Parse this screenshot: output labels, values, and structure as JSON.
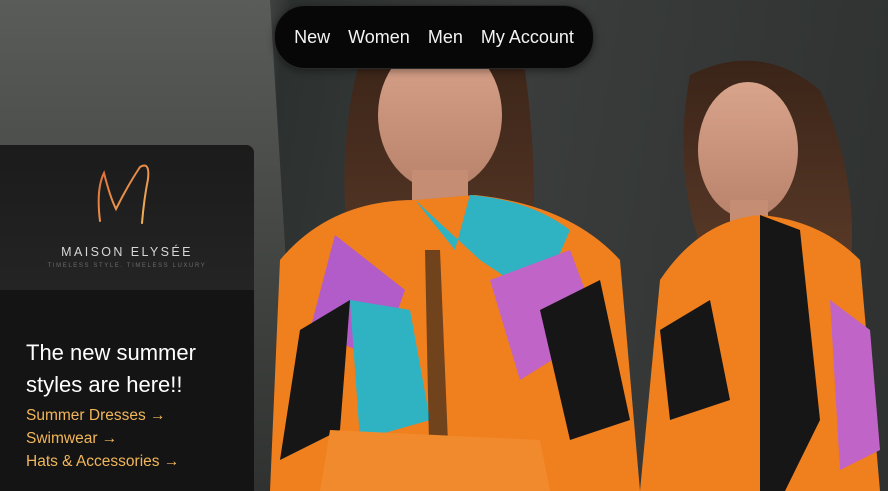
{
  "nav": {
    "items": [
      {
        "label": "New"
      },
      {
        "label": "Women"
      },
      {
        "label": "Men"
      },
      {
        "label": "My Account"
      }
    ]
  },
  "brand": {
    "name": "MAISON ELYSÉE",
    "tagline": "TIMELESS STYLE. TIMELESS LUXURY",
    "logo_letter": "M"
  },
  "promo": {
    "headline": "The new summer styles are here!!",
    "links": [
      {
        "label": "Summer Dresses →"
      },
      {
        "label": "Swimwear →"
      },
      {
        "label": "Hats & Accessories →"
      }
    ]
  },
  "colors": {
    "accent": "#f2b65a",
    "nav_bg": "#070707",
    "panel_bg": "#141414"
  },
  "hero": {
    "image": "two-models-in-colorful-geometric-silk-shirts"
  }
}
